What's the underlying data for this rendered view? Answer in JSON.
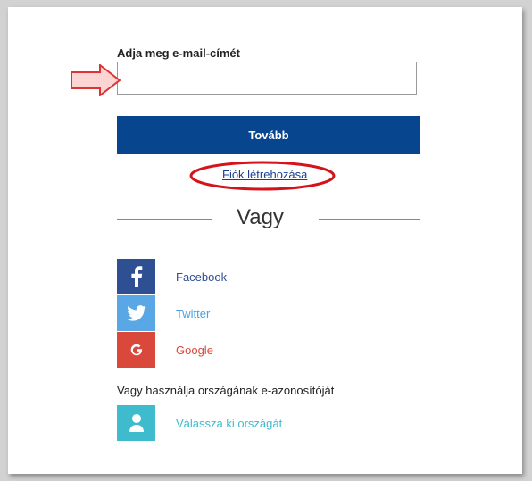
{
  "email": {
    "label": "Adja meg e-mail-címét",
    "value": "",
    "placeholder": ""
  },
  "next_button": {
    "label": "Tovább",
    "color": "#07458f"
  },
  "create_account_link": {
    "label": "Fiók létrehozása",
    "highlight_color": "#d4141a"
  },
  "divider": {
    "label": "Vagy"
  },
  "social": [
    {
      "name": "Facebook",
      "icon": "facebook-icon",
      "icon_bg": "#2f4f93",
      "text_color": "#2f4f93"
    },
    {
      "name": "Twitter",
      "icon": "twitter-icon",
      "icon_bg": "#5aa7e6",
      "text_color": "#4aa0e0"
    },
    {
      "name": "Google",
      "icon": "google-icon",
      "icon_bg": "#d9483b",
      "text_color": "#d9483b"
    }
  ],
  "country_id": {
    "note": "Vagy használja országának e-azonosítóját",
    "label": "Válassza ki országát",
    "icon": "person-icon",
    "icon_bg": "#3ebccd",
    "text_color": "#3ebccd"
  }
}
